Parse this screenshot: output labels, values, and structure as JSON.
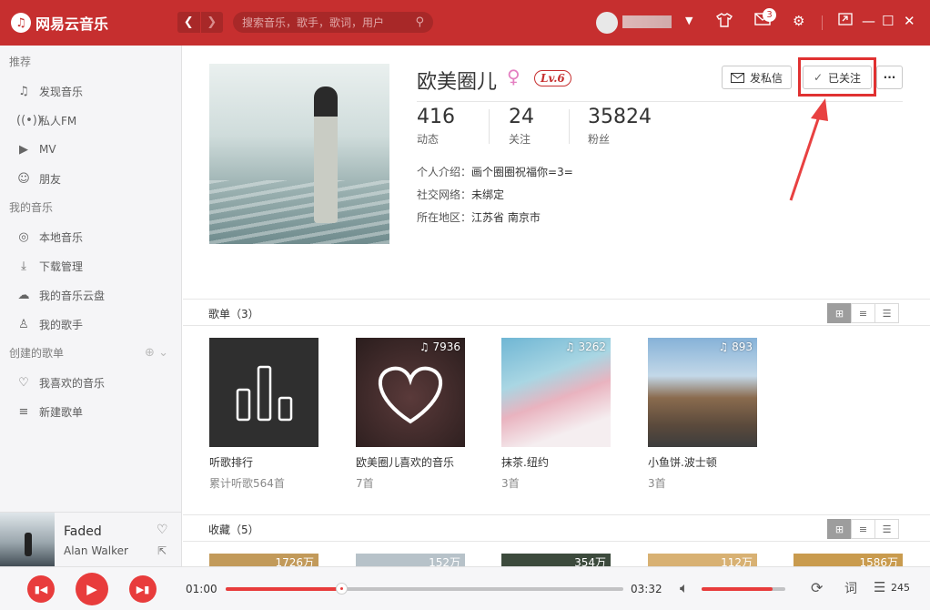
{
  "titlebar": {
    "logo_text": "网易云音乐",
    "search_placeholder": "搜索音乐，歌手，歌词，用户",
    "mail_badge": "3",
    "accent_color": "#c62f2f"
  },
  "sidebar": {
    "sections": [
      {
        "title": "推荐",
        "items": [
          {
            "icon": "music-note-icon",
            "label": "发现音乐"
          },
          {
            "icon": "radio-icon",
            "label": "私人FM"
          },
          {
            "icon": "video-icon",
            "label": "MV"
          },
          {
            "icon": "friends-icon",
            "label": "朋友"
          }
        ]
      },
      {
        "title": "我的音乐",
        "items": [
          {
            "icon": "local-music-icon",
            "label": "本地音乐"
          },
          {
            "icon": "download-icon",
            "label": "下载管理"
          },
          {
            "icon": "cloud-icon",
            "label": "我的音乐云盘"
          },
          {
            "icon": "singer-icon",
            "label": "我的歌手"
          }
        ]
      },
      {
        "title": "创建的歌单",
        "items": [
          {
            "icon": "heart-icon",
            "label": "我喜欢的音乐"
          },
          {
            "icon": "new-playlist-icon",
            "label": "新建歌单"
          }
        ]
      }
    ]
  },
  "now_playing": {
    "title": "Faded",
    "artist": "Alan Walker"
  },
  "profile": {
    "name": "欧美圈儿",
    "level": "Lv.6",
    "message_button": "发私信",
    "follow_button": "已关注",
    "stats": [
      {
        "value": "416",
        "label": "动态"
      },
      {
        "value": "24",
        "label": "关注"
      },
      {
        "value": "35824",
        "label": "粉丝"
      }
    ],
    "info": [
      {
        "key": "个人介绍：",
        "value": "画个圈圈祝福你=3="
      },
      {
        "key": "社交网络：",
        "value": "未绑定"
      },
      {
        "key": "所在地区：",
        "value": "江苏省 南京市"
      }
    ]
  },
  "playlists": {
    "title": "歌单（3）",
    "items": [
      {
        "name": "听歌排行",
        "sub": "累计听歌564首",
        "count": ""
      },
      {
        "name": "欧美圈儿喜欢的音乐",
        "sub": "7首",
        "count": "7936"
      },
      {
        "name": "抹茶.纽约",
        "sub": "3首",
        "count": "3262"
      },
      {
        "name": "小鱼饼.波士顿",
        "sub": "3首",
        "count": "893"
      }
    ]
  },
  "favorites": {
    "title": "收藏（5）",
    "counts": [
      "1726万",
      "152万",
      "354万",
      "112万",
      "1586万"
    ]
  },
  "player": {
    "current_time": "01:00",
    "total_time": "03:32",
    "progress": 0.29,
    "volume": 0.85,
    "lyrics_label": "词",
    "playlist_count": "245"
  }
}
